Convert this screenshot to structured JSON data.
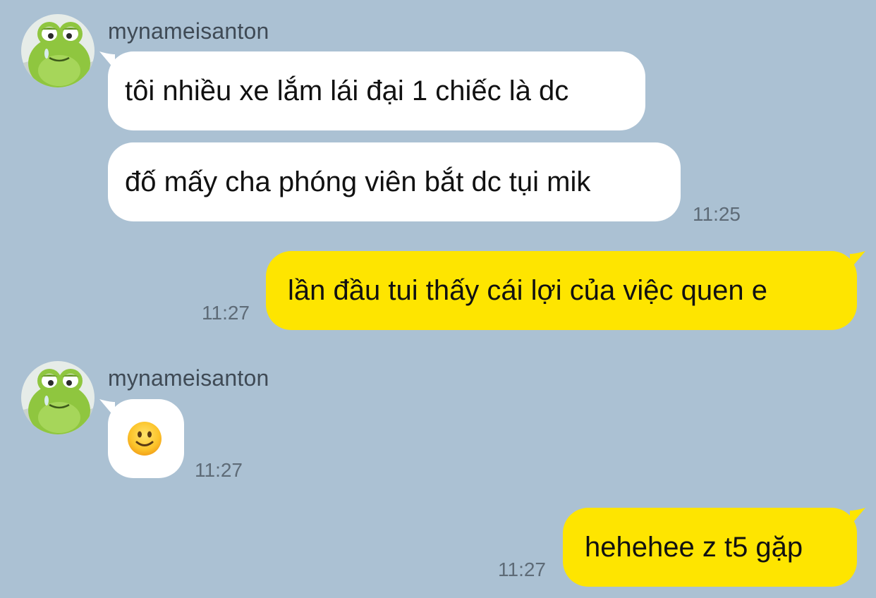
{
  "messages": [
    {
      "sender": "mynameisanton",
      "bubbles": [
        "tôi nhiều xe lắm lái đại 1 chiếc là dc",
        "đố mấy cha phóng viên bắt dc tụi mik"
      ],
      "time": "11:25"
    },
    {
      "outgoing": true,
      "text": "lần đầu tui thấy cái lợi của việc quen e",
      "time": "11:27"
    },
    {
      "sender": "mynameisanton",
      "emoji": "slightly-smiling-face",
      "time": "11:27"
    },
    {
      "outgoing": true,
      "text": "hehehee z t5 gặp",
      "time": "11:27"
    }
  ],
  "colors": {
    "background": "#abc1d3",
    "incoming_bubble": "#ffffff",
    "outgoing_bubble": "#fee500"
  }
}
